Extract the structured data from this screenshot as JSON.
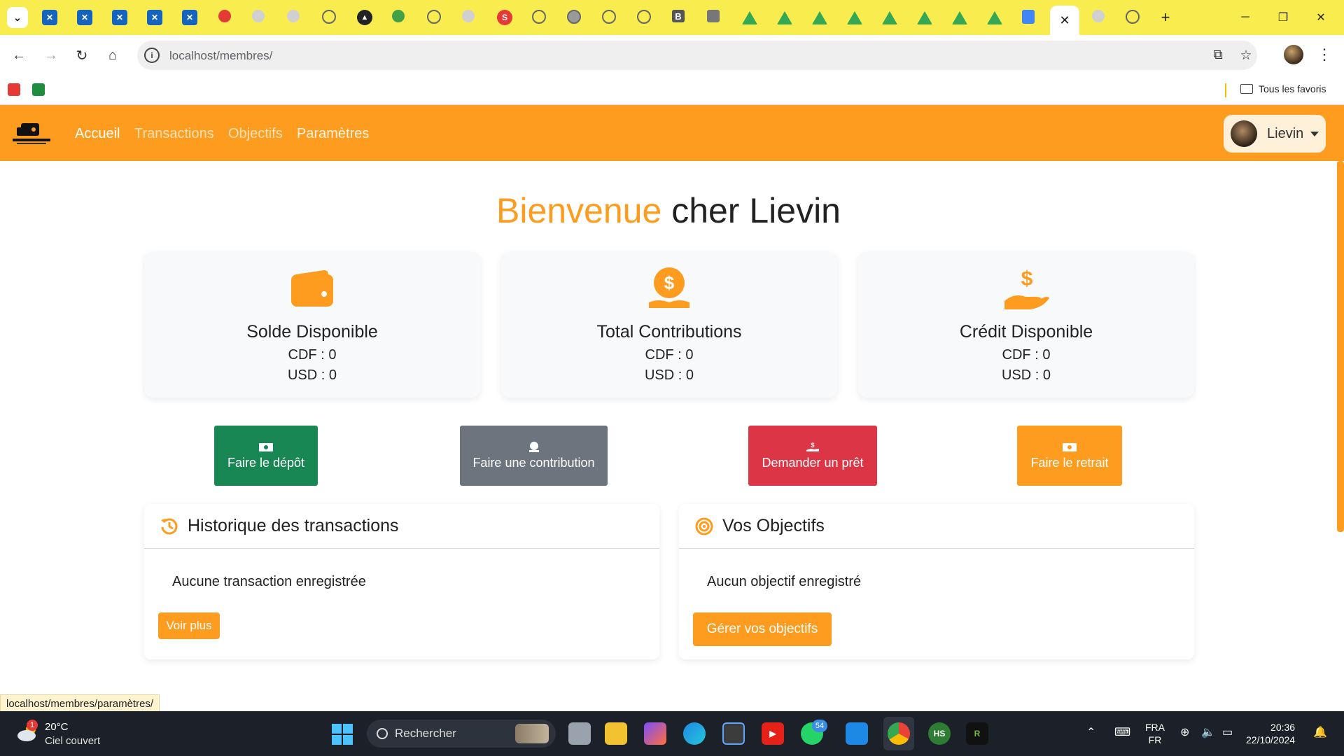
{
  "browser": {
    "url_host": "localhost",
    "url_path": "/membres/",
    "bookmarks_folder": "Tous les favoris",
    "active_tab_close": "✕"
  },
  "app": {
    "nav": {
      "links": [
        "Accueil",
        "Transactions",
        "Objectifs",
        "Paramètres"
      ],
      "active": "Accueil"
    },
    "user": {
      "name": "Lievin"
    },
    "welcome": {
      "accent": "Bienvenue",
      "rest": " cher Lievin"
    },
    "cards": [
      {
        "title": "Solde Disponible",
        "cdf": "CDF : 0",
        "usd": "USD : 0",
        "icon": "wallet-icon"
      },
      {
        "title": "Total Contributions",
        "cdf": "CDF : 0",
        "usd": "USD : 0",
        "icon": "coin-hand-icon"
      },
      {
        "title": "Crédit Disponible",
        "cdf": "CDF : 0",
        "usd": "USD : 0",
        "icon": "hand-dollar-icon"
      }
    ],
    "actions": [
      {
        "label": "Faire le dépôt",
        "color": "#198754",
        "icon": "money-icon"
      },
      {
        "label": "Faire une contribution",
        "color": "#6c757d",
        "icon": "coin-icon"
      },
      {
        "label": "Demander un prêt",
        "color": "#dc3545",
        "icon": "hand-dollar-icon"
      },
      {
        "label": "Faire le retrait",
        "color": "#fd9c1e",
        "icon": "money-icon"
      }
    ],
    "history": {
      "title": "Historique des transactions",
      "empty": "Aucune transaction enregistrée",
      "button": "Voir plus"
    },
    "goals": {
      "title": "Vos Objectifs",
      "empty": "Aucun objectif enregistré",
      "button": "Gérer vos objectifs"
    },
    "status_url": "localhost/membres/paramètres/",
    "accent_color": "#fd9c1e"
  },
  "taskbar": {
    "weather_temp": "20°C",
    "weather_desc": "Ciel couvert",
    "weather_badge": "1",
    "search_placeholder": "Rechercher",
    "whatsapp_badge": "54",
    "lang_1": "FRA",
    "lang_2": "FR",
    "time": "20:36",
    "date": "22/10/2024"
  }
}
